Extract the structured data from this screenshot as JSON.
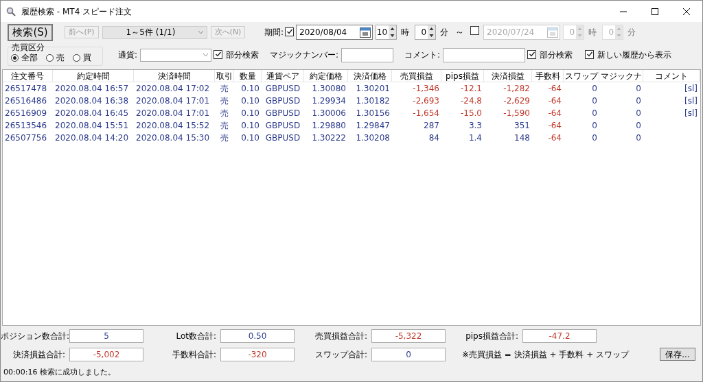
{
  "window": {
    "title": "履歴検索 - MT4 スピード注文"
  },
  "toolbar": {
    "search_button": "検索(S)",
    "prev_button": {
      "label": "前へ(P)",
      "disabled": true
    },
    "page_select": "1～5件 (1/1)",
    "next_button": {
      "label": "次へ(N)",
      "disabled": true
    },
    "period_label": "期間:",
    "start": {
      "checked": true,
      "date": "2020/08/04",
      "hour": "10",
      "hour_unit": "時",
      "minute": "0",
      "minute_unit": "分"
    },
    "tilde": "～",
    "end": {
      "checked": false,
      "date": "2020/07/24",
      "hour": "0",
      "hour_unit": "時",
      "minute": "0",
      "minute_unit": "分"
    }
  },
  "trade_type": {
    "title": "売買区分",
    "options": [
      {
        "label": "全部",
        "selected": true
      },
      {
        "label": "売",
        "selected": false
      },
      {
        "label": "買",
        "selected": false
      }
    ]
  },
  "filters": {
    "currency_label": "通貨:",
    "currency_partial": {
      "label": "部分検索",
      "checked": true
    },
    "magic_label": "マジックナンバー:",
    "comment_label": "コメント:",
    "comment_partial": {
      "label": "部分検索",
      "checked": true
    },
    "newest_first": {
      "label": "新しい履歴から表示",
      "checked": true
    }
  },
  "table": {
    "columns": [
      "注文番号",
      "約定時間",
      "決済時間",
      "取引",
      "数量",
      "通貨ペア",
      "約定価格",
      "決済価格",
      "売買損益",
      "pips損益",
      "決済損益",
      "手数料",
      "スワップ",
      "マジックナ",
      "コメント"
    ],
    "rows": [
      {
        "cells": [
          {
            "text": "26517478"
          },
          {
            "text": "2020.08.04 16:57"
          },
          {
            "text": "2020.08.04 17:02"
          },
          {
            "text": "売"
          },
          {
            "text": "0.10"
          },
          {
            "text": "GBPUSD"
          },
          {
            "text": "1.30080"
          },
          {
            "text": "1.30201"
          },
          {
            "text": "-1,346",
            "negative": true
          },
          {
            "text": "-12.1",
            "negative": true
          },
          {
            "text": "-1,282",
            "negative": true
          },
          {
            "text": "-64",
            "negative": true
          },
          {
            "text": "0"
          },
          {
            "text": "0"
          },
          {
            "text": "[sl]"
          }
        ]
      },
      {
        "cells": [
          {
            "text": "26516486"
          },
          {
            "text": "2020.08.04 16:38"
          },
          {
            "text": "2020.08.04 17:01"
          },
          {
            "text": "売"
          },
          {
            "text": "0.10"
          },
          {
            "text": "GBPUSD"
          },
          {
            "text": "1.29934"
          },
          {
            "text": "1.30182"
          },
          {
            "text": "-2,693",
            "negative": true
          },
          {
            "text": "-24.8",
            "negative": true
          },
          {
            "text": "-2,629",
            "negative": true
          },
          {
            "text": "-64",
            "negative": true
          },
          {
            "text": "0"
          },
          {
            "text": "0"
          },
          {
            "text": "[sl]"
          }
        ]
      },
      {
        "cells": [
          {
            "text": "26516909"
          },
          {
            "text": "2020.08.04 16:45"
          },
          {
            "text": "2020.08.04 17:01"
          },
          {
            "text": "売"
          },
          {
            "text": "0.10"
          },
          {
            "text": "GBPUSD"
          },
          {
            "text": "1.30006"
          },
          {
            "text": "1.30156"
          },
          {
            "text": "-1,654",
            "negative": true
          },
          {
            "text": "-15.0",
            "negative": true
          },
          {
            "text": "-1,590",
            "negative": true
          },
          {
            "text": "-64",
            "negative": true
          },
          {
            "text": "0"
          },
          {
            "text": "0"
          },
          {
            "text": "[sl]"
          }
        ]
      },
      {
        "cells": [
          {
            "text": "26513546"
          },
          {
            "text": "2020.08.04 15:51"
          },
          {
            "text": "2020.08.04 15:52"
          },
          {
            "text": "売"
          },
          {
            "text": "0.10"
          },
          {
            "text": "GBPUSD"
          },
          {
            "text": "1.29880"
          },
          {
            "text": "1.29847"
          },
          {
            "text": "287",
            "negative": false
          },
          {
            "text": "3.3",
            "negative": false
          },
          {
            "text": "351",
            "negative": false
          },
          {
            "text": "-64",
            "negative": true
          },
          {
            "text": "0"
          },
          {
            "text": "0"
          }
        ]
      },
      {
        "cells": [
          {
            "text": "26507756"
          },
          {
            "text": "2020.08.04 14:20"
          },
          {
            "text": "2020.08.04 15:30"
          },
          {
            "text": "売"
          },
          {
            "text": "0.10"
          },
          {
            "text": "GBPUSD"
          },
          {
            "text": "1.30222"
          },
          {
            "text": "1.30208"
          },
          {
            "text": "84",
            "negative": false
          },
          {
            "text": "1.4",
            "negative": false
          },
          {
            "text": "148",
            "negative": false
          },
          {
            "text": "-64",
            "negative": true
          },
          {
            "text": "0"
          },
          {
            "text": "0"
          }
        ]
      }
    ]
  },
  "totals": [
    {
      "label": "ポジション数合計:",
      "value": "5",
      "negative": false
    },
    {
      "label": "Lot数合計:",
      "value": "0.50",
      "negative": false
    },
    {
      "label": "売買損益合計:",
      "value": "-5,322",
      "negative": true
    },
    {
      "label": "pips損益合計:",
      "value": "-47.2",
      "negative": true
    },
    {
      "label": "決済損益合計:",
      "value": "-5,002",
      "negative": true
    },
    {
      "label": "手数料合計:",
      "value": "-320",
      "negative": true
    },
    {
      "label": "スワップ合計:",
      "value": "0",
      "negative": false
    }
  ],
  "formula_note": "※売買損益 = 決済損益 + 手数料 + スワップ",
  "save_button": "保存...",
  "status_bar": "00:00:16 検索に成功しました。"
}
